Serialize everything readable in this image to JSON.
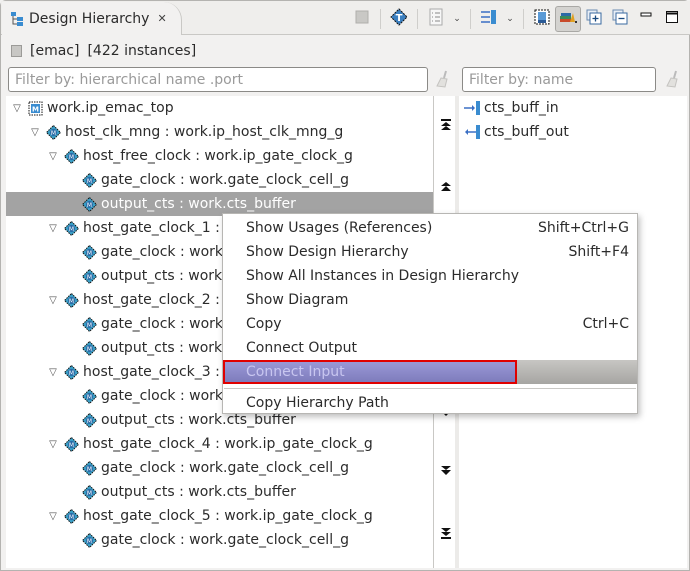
{
  "view": {
    "title": "Design Hierarchy",
    "close_glyph": "✕"
  },
  "toolbar": {
    "buttons": [
      {
        "name": "stop",
        "icon": "stop-icon"
      },
      {
        "name": "toggle-testbench",
        "icon": "chip-t-icon"
      },
      {
        "name": "view-menu",
        "icon": "list-icon",
        "dropdown": true
      },
      {
        "name": "layout-menu",
        "icon": "sliders-icon",
        "dropdown": true
      },
      {
        "name": "show-instances",
        "icon": "chip-print-icon"
      },
      {
        "name": "link-with-editor",
        "icon": "books-icon",
        "pressed": true
      },
      {
        "name": "expand-all",
        "icon": "expand-all-icon"
      },
      {
        "name": "collapse-all",
        "icon": "collapse-all-icon"
      },
      {
        "name": "minimize",
        "icon": "minimize-icon"
      },
      {
        "name": "maximize",
        "icon": "maximize-icon"
      }
    ],
    "dropdown_glyph": "⌄"
  },
  "info": {
    "scope": "[emac]",
    "count": "[422 instances]"
  },
  "filters": {
    "hierarchy_placeholder": "Filter by: hierarchical name .port",
    "hierarchy_value": "",
    "ports_placeholder": "Filter by: name",
    "ports_value": ""
  },
  "tree": {
    "rows": [
      {
        "level": 0,
        "expanded": true,
        "icon": "module-icon",
        "label": "work.ip_emac_top"
      },
      {
        "level": 1,
        "expanded": true,
        "icon": "instance-icon",
        "label": "host_clk_mng : work.ip_host_clk_mng_g"
      },
      {
        "level": 2,
        "expanded": true,
        "icon": "instance-icon",
        "label": "host_free_clock : work.ip_gate_clock_g"
      },
      {
        "level": 3,
        "expanded": null,
        "icon": "instance-icon",
        "label": "gate_clock : work.gate_clock_cell_g"
      },
      {
        "level": 3,
        "expanded": null,
        "icon": "instance-icon",
        "label": "output_cts : work.cts_buffer",
        "selected": true
      },
      {
        "level": 2,
        "expanded": true,
        "icon": "instance-icon",
        "label": "host_gate_clock_1 : work.ip_gate_clock_g"
      },
      {
        "level": 3,
        "expanded": null,
        "icon": "instance-icon",
        "label": "gate_clock : work.gate_clock_cell_g"
      },
      {
        "level": 3,
        "expanded": null,
        "icon": "instance-icon",
        "label": "output_cts : work.cts_buffer"
      },
      {
        "level": 2,
        "expanded": true,
        "icon": "instance-icon",
        "label": "host_gate_clock_2 : work.ip_gate_clock_g"
      },
      {
        "level": 3,
        "expanded": null,
        "icon": "instance-icon",
        "label": "gate_clock : work.gate_clock_cell_g"
      },
      {
        "level": 3,
        "expanded": null,
        "icon": "instance-icon",
        "label": "output_cts : work.cts_buffer"
      },
      {
        "level": 2,
        "expanded": true,
        "icon": "instance-icon",
        "label": "host_gate_clock_3 : work.ip_gate_clock_g"
      },
      {
        "level": 3,
        "expanded": null,
        "icon": "instance-icon",
        "label": "gate_clock : work.gate_clock_cell_g"
      },
      {
        "level": 3,
        "expanded": null,
        "icon": "instance-icon",
        "label": "output_cts : work.cts_buffer"
      },
      {
        "level": 2,
        "expanded": true,
        "icon": "instance-icon",
        "label": "host_gate_clock_4 : work.ip_gate_clock_g"
      },
      {
        "level": 3,
        "expanded": null,
        "icon": "instance-icon",
        "label": "gate_clock : work.gate_clock_cell_g"
      },
      {
        "level": 3,
        "expanded": null,
        "icon": "instance-icon",
        "label": "output_cts : work.cts_buffer"
      },
      {
        "level": 2,
        "expanded": true,
        "icon": "instance-icon",
        "label": "host_gate_clock_5 : work.ip_gate_clock_g"
      },
      {
        "level": 3,
        "expanded": null,
        "icon": "instance-icon",
        "label": "gate_clock : work.gate_clock_cell_g"
      }
    ],
    "expanded_glyph": "▽"
  },
  "nav": {
    "buttons": [
      {
        "name": "scroll-top",
        "glyph": "⤒"
      },
      {
        "name": "scroll-up",
        "glyph": "⏶"
      },
      {
        "name": "scroll-down",
        "glyph": "⏷"
      },
      {
        "name": "page-down",
        "glyph": "⏬"
      },
      {
        "name": "scroll-bottom",
        "glyph": "⤓"
      }
    ]
  },
  "ports": {
    "items": [
      {
        "direction": "in",
        "label": "cts_buff_in"
      },
      {
        "direction": "out",
        "label": "cts_buff_out"
      }
    ]
  },
  "context_menu": {
    "items": [
      {
        "label": "Show Usages (References)",
        "shortcut": "Shift+Ctrl+G"
      },
      {
        "label": "Show Design Hierarchy",
        "shortcut": "Shift+F4"
      },
      {
        "label": "Show All Instances in Design Hierarchy",
        "shortcut": ""
      },
      {
        "label": "Show Diagram",
        "shortcut": ""
      },
      {
        "label": "Copy",
        "shortcut": "Ctrl+C"
      },
      {
        "label": "Connect Output",
        "shortcut": ""
      },
      {
        "label": "Connect Input",
        "shortcut": "",
        "highlighted": true,
        "disabled": true
      },
      {
        "label": "Copy Hierarchy Path",
        "shortcut": "",
        "after_separator": true
      }
    ]
  },
  "colors": {
    "selection": "#a3a3a3",
    "menu_highlight": "#8a88c8",
    "annotation_box": "#e00000",
    "port_icon": "#3a6fc4"
  }
}
